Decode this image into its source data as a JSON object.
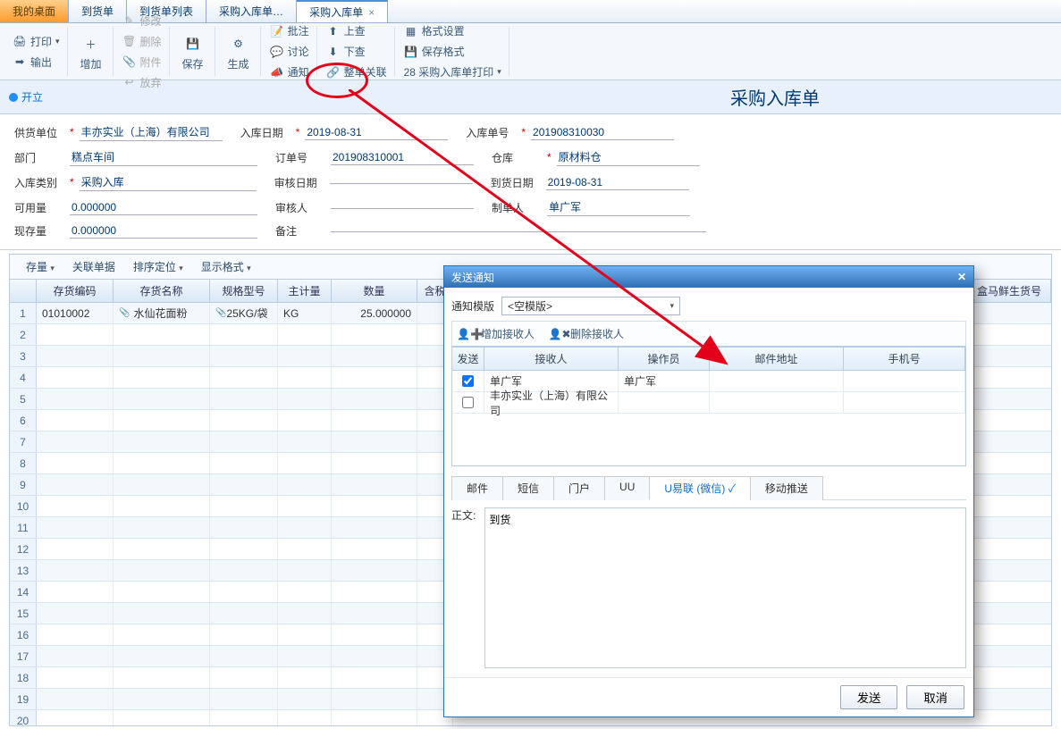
{
  "tabs": {
    "desktop": "我的桌面",
    "t1": "到货单",
    "t2": "到货单列表",
    "t3": "采购入库单…",
    "active": "采购入库单"
  },
  "toolbar": {
    "print": "打印",
    "output": "输出",
    "add": "增加",
    "modify": "修改",
    "delete": "删除",
    "attach": "附件",
    "abandon": "放弃",
    "save": "保存",
    "generate": "生成",
    "approve": "批注",
    "discuss": "讨论",
    "notify": "通知",
    "lookup": "上查",
    "lookdown": "下查",
    "relate": "整单关联",
    "format": "格式设置",
    "saveformat": "保存格式",
    "printtpl": "28 采购入库单打印"
  },
  "status": {
    "open": "开立"
  },
  "page_title": "采购入库单",
  "form": {
    "supplier_label": "供货单位",
    "supplier": "丰亦实业（上海）有限公司",
    "indate_label": "入库日期",
    "indate": "2019-08-31",
    "docno_label": "入库单号",
    "docno": "201908310030",
    "dept_label": "部门",
    "dept": "糕点车间",
    "orderno_label": "订单号",
    "orderno": "201908310001",
    "wh_label": "仓库",
    "wh": "原材料仓",
    "intype_label": "入库类别",
    "intype": "采购入库",
    "auditdate_label": "审核日期",
    "auditdate": "",
    "arrdate_label": "到货日期",
    "arrdate": "2019-08-31",
    "avail_label": "可用量",
    "avail": "0.000000",
    "auditor_label": "审核人",
    "auditor": "",
    "maker_label": "制单人",
    "maker": "单广军",
    "stock_label": "现存量",
    "stock": "0.000000",
    "remark_label": "备注",
    "remark": ""
  },
  "grid_toolbar": {
    "inv": "存量",
    "rel": "关联单据",
    "sort": "排序定位",
    "disp": "显示格式"
  },
  "grid_headers": {
    "code": "存货编码",
    "name": "存货名称",
    "spec": "规格型号",
    "unit": "主计量",
    "qty": "数量",
    "tax": "含税",
    "hema": "盒马鲜生货号"
  },
  "grid_row": {
    "code": "01010002",
    "name": "水仙花面粉",
    "spec": "25KG/袋",
    "unit": "KG",
    "qty": "25.000000"
  },
  "dialog": {
    "title": "发送通知",
    "tpl_label": "通知模版",
    "tpl_value": "<空模版>",
    "add_recv": "增加接收人",
    "del_recv": "删除接收人",
    "h_send": "发送",
    "h_recv": "接收人",
    "h_op": "操作员",
    "h_email": "邮件地址",
    "h_phone": "手机号",
    "r1_recv": "单广军",
    "r1_op": "单广军",
    "r2_recv": "丰亦实业（上海）有限公司",
    "tab_mail": "邮件",
    "tab_sms": "短信",
    "tab_portal": "门户",
    "tab_uu": "UU",
    "tab_wechat": "U易联 (微信) ✓",
    "tab_push": "移动推送",
    "body_label": "正文:",
    "body_text": "到货",
    "send": "发送",
    "cancel": "取消"
  }
}
